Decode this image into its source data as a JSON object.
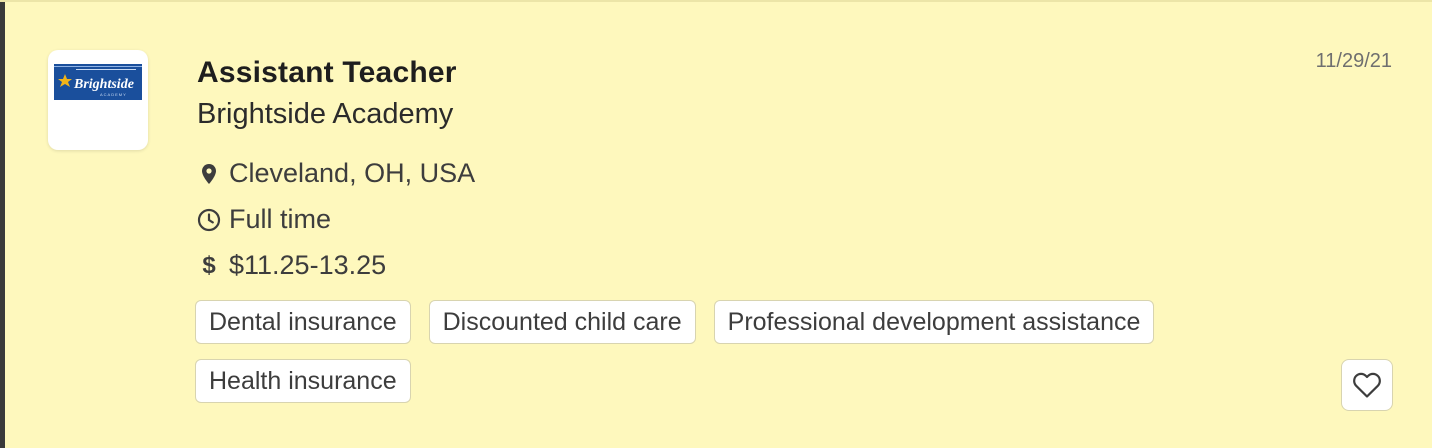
{
  "job": {
    "title": "Assistant Teacher",
    "company": "Brightside Academy",
    "posted_date": "11/29/21",
    "location": "Cleveland, OH, USA",
    "job_type": "Full time",
    "pay": "$11.25-13.25",
    "pay_symbol": "$",
    "logo": {
      "wordmark": "Brightside",
      "subtext": "ACADEMY",
      "color": "#1a4f9c",
      "accent": "#f2b418"
    }
  },
  "benefits": [
    "Dental insurance",
    "Discounted child care",
    "Professional development assistance",
    "Health insurance"
  ],
  "icons": {
    "location": "map-pin-icon",
    "job_type": "clock-icon",
    "pay": "dollar-icon",
    "favorite": "heart-icon"
  },
  "colors": {
    "card_background": "#fef8bd",
    "accent_bar": "#3a3a3a"
  }
}
